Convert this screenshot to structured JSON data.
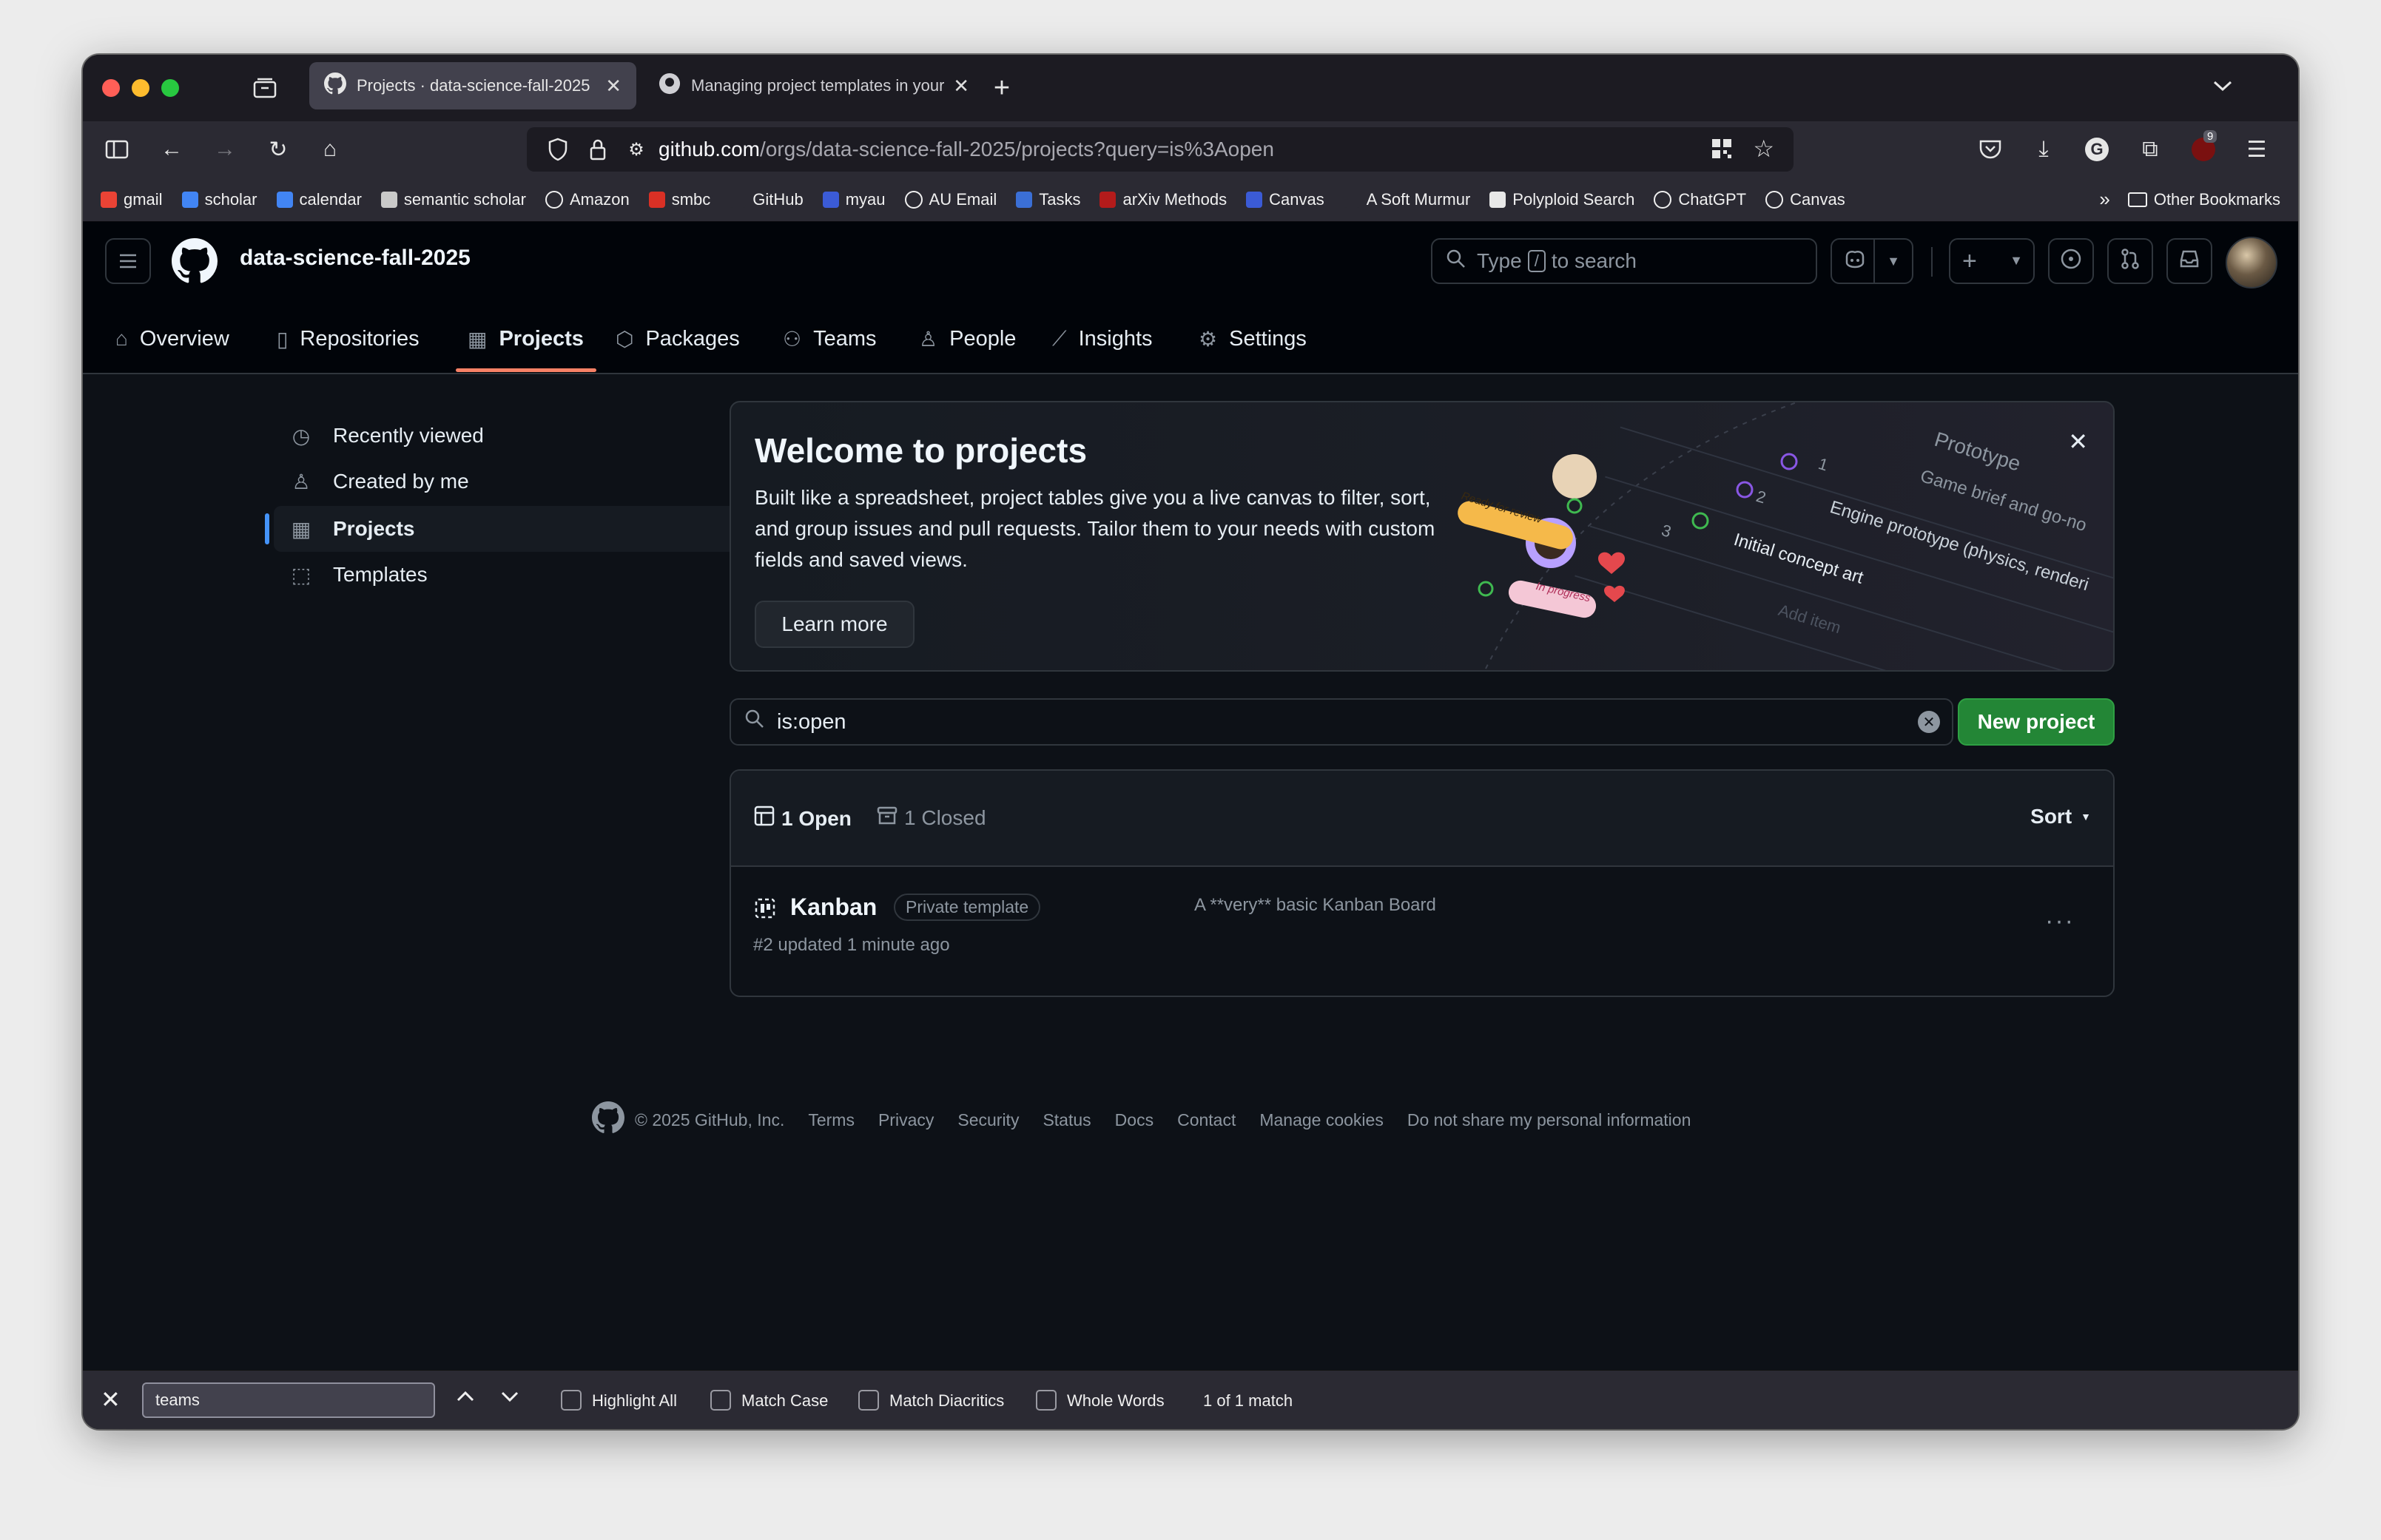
{
  "browser": {
    "tabs": [
      {
        "title": "Projects · data-science-fall-2025",
        "active": true
      },
      {
        "title": "Managing project templates in your organization",
        "active": false
      }
    ],
    "url": {
      "host": "github.com",
      "path": "/orgs/data-science-fall-2025/projects?query=is%3Aopen"
    },
    "extension_badge": "9",
    "bookmarks": [
      {
        "label": "gmail",
        "icon": "gmail-icon",
        "color": "#ea4335"
      },
      {
        "label": "scholar",
        "icon": "scholar-icon",
        "color": "#4285f4"
      },
      {
        "label": "calendar",
        "icon": "calendar-icon",
        "color": "#4285f4"
      },
      {
        "label": "semantic scholar",
        "icon": "semantic-scholar-icon",
        "color": "#c9c9c9"
      },
      {
        "label": "Amazon",
        "icon": "globe-icon",
        "color": "#2b2a33"
      },
      {
        "label": "smbc",
        "icon": "smbc-icon",
        "color": "#d93025"
      },
      {
        "label": "GitHub",
        "icon": "github-icon",
        "color": "#2b2a33"
      },
      {
        "label": "myau",
        "icon": "au-icon",
        "color": "#3b5bd6"
      },
      {
        "label": "AU Email",
        "icon": "globe-icon",
        "color": "#2b2a33"
      },
      {
        "label": "Tasks",
        "icon": "tasks-icon",
        "color": "#3b6fd6"
      },
      {
        "label": "arXiv Methods",
        "icon": "arxiv-icon",
        "color": "#b31b1b"
      },
      {
        "label": "Canvas",
        "icon": "au-icon",
        "color": "#3b5bd6"
      },
      {
        "label": "A Soft Murmur",
        "icon": "drop-icon",
        "color": "#2b2a33"
      },
      {
        "label": "Polyploid Search",
        "icon": "polyploid-icon",
        "color": "#e8e8e8"
      },
      {
        "label": "ChatGPT",
        "icon": "globe-icon",
        "color": "#2b2a33"
      },
      {
        "label": "Canvas",
        "icon": "globe-icon",
        "color": "#2b2a33"
      }
    ],
    "other_bookmarks": "Other Bookmarks"
  },
  "github": {
    "org_name": "data-science-fall-2025",
    "search_placeholder_pre": "Type",
    "search_key": "/",
    "search_placeholder_post": "to search",
    "nav": [
      {
        "label": "Overview",
        "icon": "home-icon"
      },
      {
        "label": "Repositories",
        "icon": "repo-icon"
      },
      {
        "label": "Projects",
        "icon": "table-icon",
        "selected": true
      },
      {
        "label": "Packages",
        "icon": "package-icon"
      },
      {
        "label": "Teams",
        "icon": "people-icon"
      },
      {
        "label": "People",
        "icon": "person-icon"
      },
      {
        "label": "Insights",
        "icon": "graph-icon"
      },
      {
        "label": "Settings",
        "icon": "gear-icon"
      }
    ],
    "sidebar": [
      {
        "label": "Recently viewed",
        "icon": "clock-icon"
      },
      {
        "label": "Created by me",
        "icon": "person-icon"
      },
      {
        "label": "Projects",
        "icon": "table-icon",
        "selected": true
      },
      {
        "label": "Templates",
        "icon": "template-icon"
      }
    ],
    "banner": {
      "title": "Welcome to projects",
      "body": "Built like a spreadsheet, project tables give you a live canvas to filter, sort, and group issues and pull requests. Tailor them to your needs with custom fields and saved views.",
      "button": "Learn more",
      "illustration": {
        "heading": "Prototype",
        "rows": [
          {
            "num": "1",
            "text": "Game brief and go-no"
          },
          {
            "num": "2",
            "text": "Engine prototype (physics, renderi"
          },
          {
            "num": "3",
            "text": "Initial concept art"
          }
        ],
        "add_item": "Add item",
        "tag_review": "Ready for review",
        "tag_progress": "In progress"
      }
    },
    "filter": {
      "value": "is:open"
    },
    "new_project_button": "New project",
    "list": {
      "open_label": "1 Open",
      "closed_label": "1 Closed",
      "sort_label": "Sort",
      "items": [
        {
          "title": "Kanban",
          "badge": "Private template",
          "description": "A **very** basic Kanban Board",
          "meta": "#2 updated 1 minute ago"
        }
      ]
    },
    "footer": {
      "copyright": "© 2025 GitHub, Inc.",
      "links": [
        "Terms",
        "Privacy",
        "Security",
        "Status",
        "Docs",
        "Contact",
        "Manage cookies",
        "Do not share my personal information"
      ]
    }
  },
  "findbar": {
    "query": "teams",
    "options": [
      "Highlight All",
      "Match Case",
      "Match Diacritics",
      "Whole Words"
    ],
    "status": "1 of 1 match"
  },
  "colors": {
    "accent_orange": "#f78166",
    "primary_green": "#238636",
    "sidebar_selected": "#4493f8"
  }
}
